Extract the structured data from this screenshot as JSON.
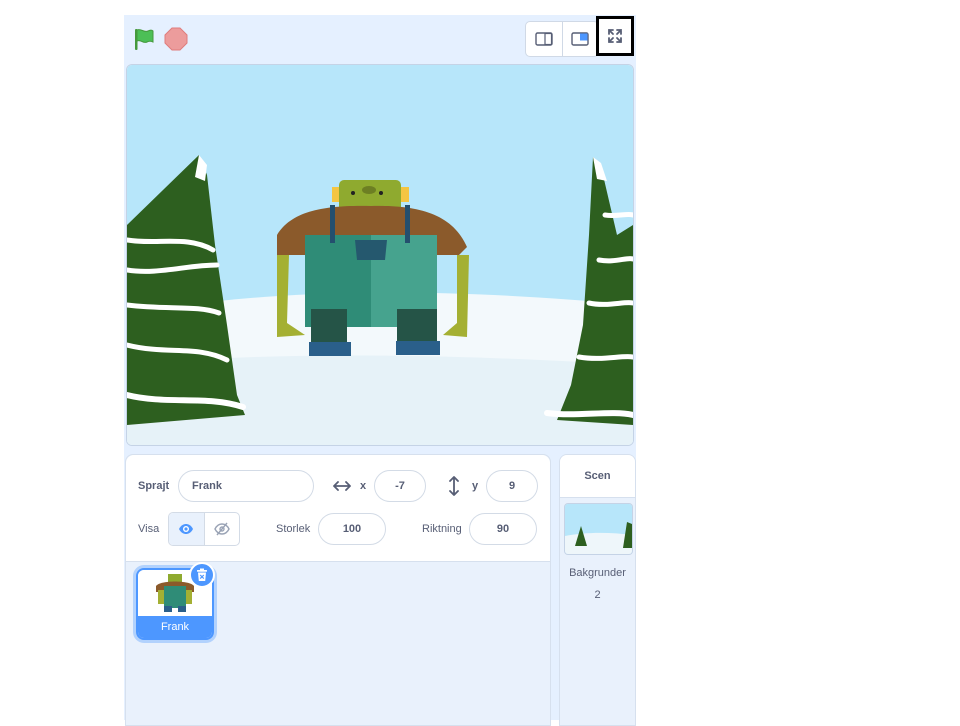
{
  "sprite_info": {
    "sprite_label": "Sprajt",
    "sprite_name": "Frank",
    "x_label": "x",
    "x_value": "-7",
    "y_label": "y",
    "y_value": "9",
    "show_label": "Visa",
    "size_label": "Storlek",
    "size_value": "100",
    "direction_label": "Riktning",
    "direction_value": "90"
  },
  "sprites": [
    {
      "name": "Frank",
      "selected": true
    }
  ],
  "stage_selector": {
    "header": "Scen",
    "backdrops_label": "Bakgrunder",
    "backdrops_count": "2"
  },
  "colors": {
    "accent": "#4d97ff",
    "flag": "#4cbf56",
    "stop": "#ec9c9c",
    "sky": "#b7e6fa",
    "tree": "#2d5f1f"
  },
  "icons": {
    "green_flag": "flag-icon",
    "stop": "stop-icon",
    "small_stage": "small-stage-icon",
    "large_stage": "large-stage-icon",
    "fullscreen": "fullscreen-icon",
    "show": "eye-icon",
    "hide": "eye-slash-icon",
    "delete": "trash-icon"
  }
}
